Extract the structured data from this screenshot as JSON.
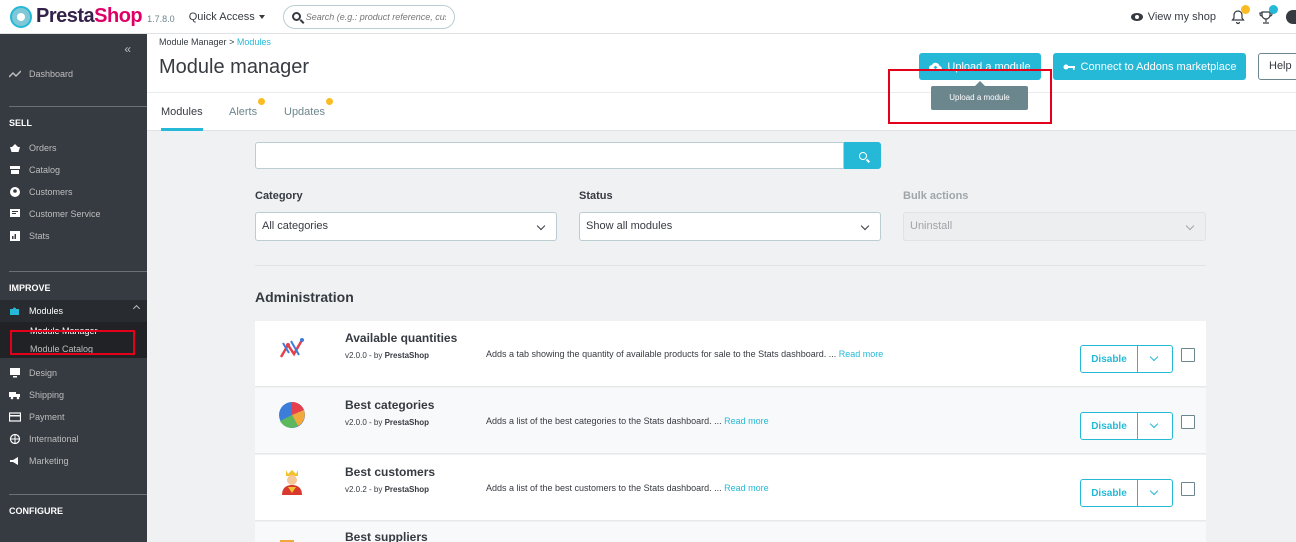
{
  "header": {
    "brand_a": "Presta",
    "brand_b": "Shop",
    "version": "1.7.8.0",
    "quick_access": "Quick Access",
    "search_placeholder": "Search (e.g.: product reference, custon",
    "view_shop": "View my shop"
  },
  "sidebar": {
    "collapse": "«",
    "dashboard": "Dashboard",
    "sell_title": "SELL",
    "sell_items": [
      "Orders",
      "Catalog",
      "Customers",
      "Customer Service",
      "Stats"
    ],
    "improve_title": "IMPROVE",
    "modules": "Modules",
    "module_manager": "Module Manager",
    "module_catalog": "Module Catalog",
    "improve_items": [
      "Design",
      "Shipping",
      "Payment",
      "International",
      "Marketing"
    ],
    "configure_title": "CONFIGURE"
  },
  "page": {
    "breadcrumb_parent": "Module Manager",
    "breadcrumb_sep": ">",
    "breadcrumb_current": "Modules",
    "title": "Module manager",
    "upload_button": "Upload a module",
    "connect_button": "Connect to Addons marketplace",
    "help_button": "Help",
    "tooltip": "Upload a module"
  },
  "tabs": [
    "Modules",
    "Alerts",
    "Updates"
  ],
  "filters": {
    "search_value": "",
    "category_label": "Category",
    "category_value": "All categories",
    "status_label": "Status",
    "status_value": "Show all modules",
    "bulk_label": "Bulk actions",
    "bulk_value": "Uninstall"
  },
  "section_title": "Administration",
  "modules": [
    {
      "name": "Available quantities",
      "version": "v2.0.0 - by",
      "author": "PrestaShop",
      "description": "Adds a tab showing the quantity of available products for sale to the Stats dashboard. ...",
      "read_more": "Read more",
      "action": "Disable"
    },
    {
      "name": "Best categories",
      "version": "v2.0.0 - by",
      "author": "PrestaShop",
      "description": "Adds a list of the best categories to the Stats dashboard. ...",
      "read_more": "Read more",
      "action": "Disable"
    },
    {
      "name": "Best customers",
      "version": "v2.0.2 - by",
      "author": "PrestaShop",
      "description": "Adds a list of the best customers to the Stats dashboard. ...",
      "read_more": "Read more",
      "action": "Disable"
    },
    {
      "name": "Best suppliers",
      "version": "",
      "author": "",
      "description": "",
      "read_more": "",
      "action": ""
    }
  ],
  "colors": {
    "accent": "#25b9d7",
    "sidebar_bg": "#363a41",
    "highlight_red": "#e4001b",
    "badge_orange": "#fbbb22"
  }
}
